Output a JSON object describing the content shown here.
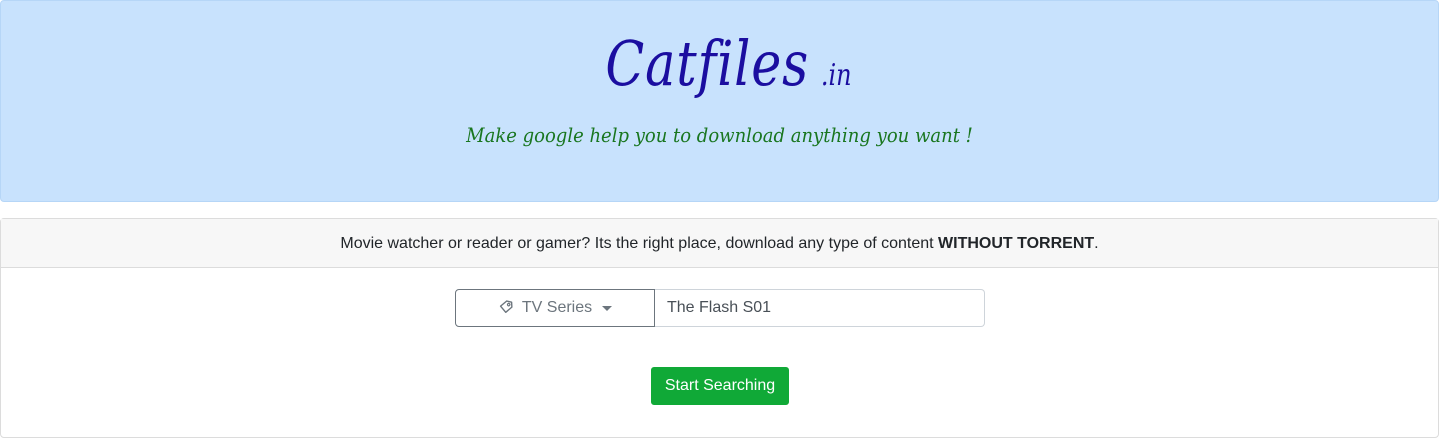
{
  "brand": {
    "name": "Catfiles",
    "tld": ".in",
    "tagline": "Make google help you to download anything you want !"
  },
  "intro": {
    "text": "Movie watcher or reader or gamer? Its the right place, download any type of content ",
    "emphasis": "WITHOUT TORRENT",
    "suffix": "."
  },
  "search": {
    "category_label": "TV Series",
    "category_icon": "tag-icon",
    "query_value": "The Flash S01",
    "button_label": "Start Searching"
  },
  "colors": {
    "header_bg": "#c8e2fd",
    "brand": "#1b0ea0",
    "tagline": "#19761f",
    "button": "#10a937"
  }
}
